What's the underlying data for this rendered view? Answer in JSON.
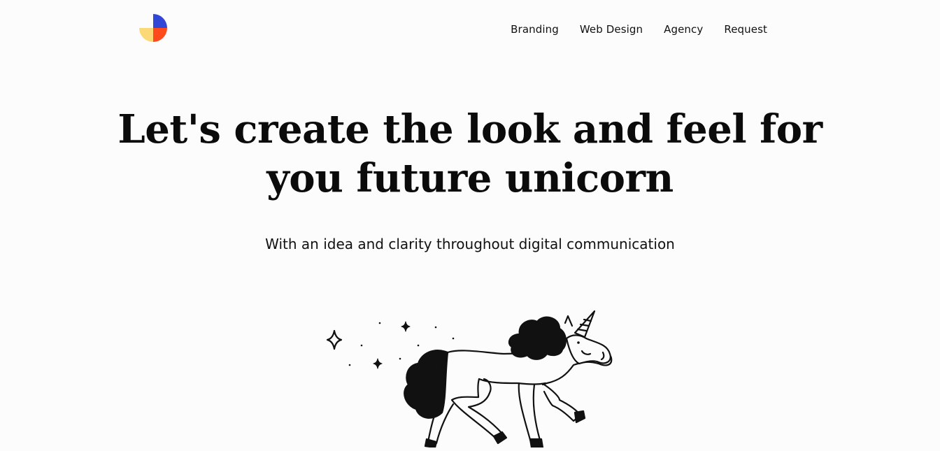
{
  "header": {
    "logo_icon": "quartered-circle-logo-icon",
    "nav": [
      {
        "label": "Branding"
      },
      {
        "label": "Web Design"
      },
      {
        "label": "Agency"
      },
      {
        "label": "Request"
      }
    ]
  },
  "hero": {
    "headline_line1": "Let's create the look and feel for",
    "headline_line2": "you future unicorn",
    "subtitle": "With an idea and clarity throughout digital communication",
    "illustration_icon": "unicorn-illustration"
  },
  "colors": {
    "background": "#fcfcfc",
    "logo_blue": "#3347d6",
    "logo_orange": "#ff4a1c",
    "logo_yellow": "#fcd977",
    "text": "#111111"
  }
}
